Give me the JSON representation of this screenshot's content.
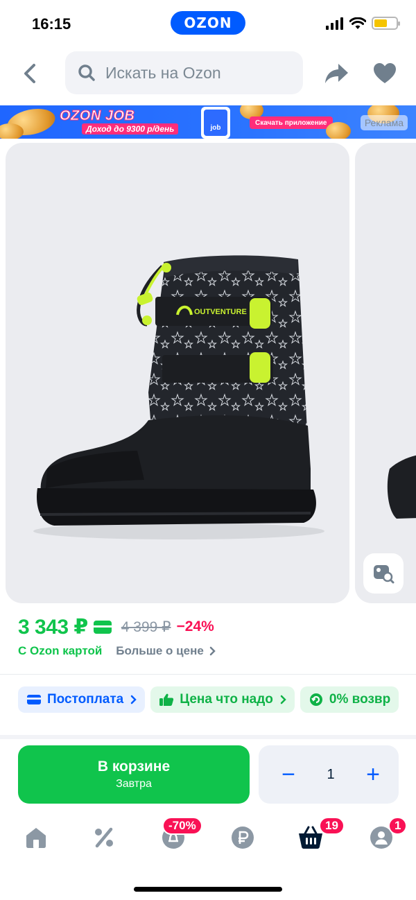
{
  "status_bar": {
    "time": "16:15",
    "brand": "OZON"
  },
  "header": {
    "search_placeholder": "Искать на Ozon"
  },
  "banner": {
    "title": "OZON JOB",
    "subtitle": "Доход до 9300 р/день",
    "phone_label": "job",
    "cta": "Скачать приложение",
    "ad_label": "Реклама"
  },
  "product": {
    "brand_on_boot": "OUTVENTURE",
    "price": "3 343 ₽",
    "old_price": "4 399 ₽",
    "discount": "−24%",
    "card_label": "С Ozon картой",
    "more_price": "Больше о цене"
  },
  "chips": [
    {
      "label": "Постоплата"
    },
    {
      "label": "Цена что надо"
    },
    {
      "label": "0% возвр"
    }
  ],
  "cart": {
    "label": "В корзине",
    "delivery": "Завтра",
    "quantity": "1"
  },
  "bottom_nav": {
    "sale_badge": "-70%",
    "cart_badge": "19",
    "profile_badge": "1"
  },
  "colors": {
    "accent": "#005bff",
    "green": "#10c44c",
    "red": "#f91155"
  }
}
